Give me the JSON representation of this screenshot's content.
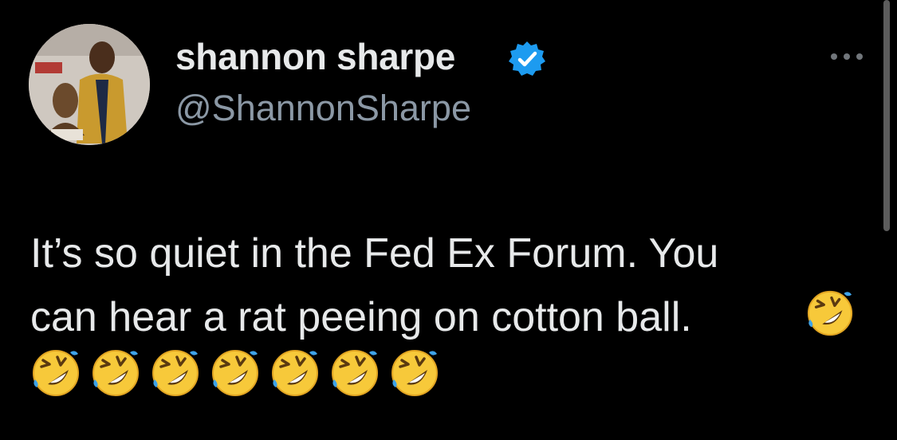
{
  "author": {
    "display_name": "shannon sharpe",
    "handle": "@ShannonSharpe",
    "verified": true
  },
  "tweet": {
    "lines": [
      "It’s so quiet in the Fed Ex Forum. You",
      "can hear a rat peeing on cotton ball."
    ],
    "emojis": [
      "🤣",
      "🤣",
      "🤣",
      "🤣",
      "🤣",
      "🤣",
      "🤣",
      "🤣"
    ]
  },
  "icons": {
    "verified_badge": "verified-badge-icon",
    "more": "more-options-icon",
    "emoji": "rolling-on-floor-laughing-emoji"
  },
  "colors": {
    "background": "#000000",
    "text": "#e7e9ea",
    "secondary_text": "#8b98a5",
    "verified_blue": "#1d9bf0"
  }
}
